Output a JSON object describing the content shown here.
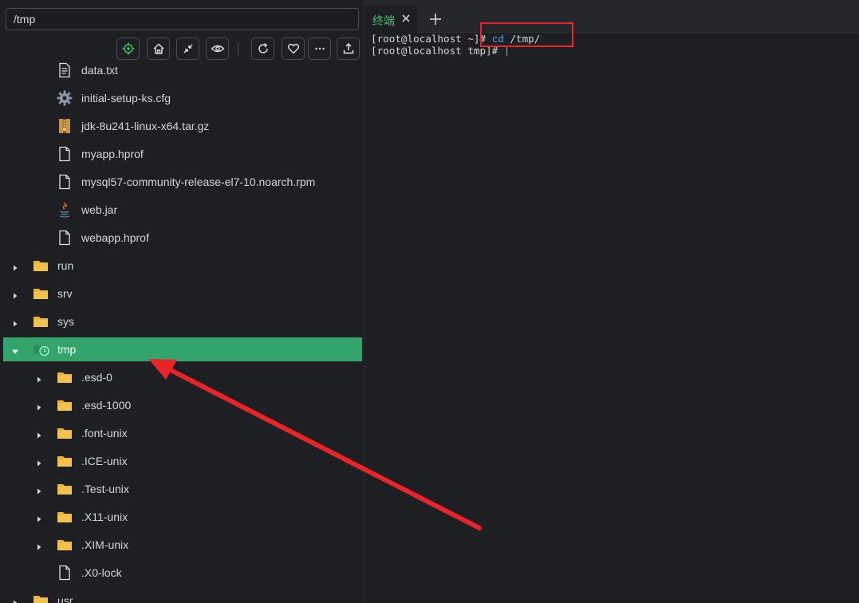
{
  "path_bar": {
    "value": "/tmp"
  },
  "toolbar": {
    "buttons": [
      {
        "icon": "locate-icon"
      },
      {
        "icon": "home-icon"
      },
      {
        "icon": "collapse-icon"
      },
      {
        "icon": "eye-icon"
      },
      {
        "icon": "refresh-icon"
      },
      {
        "icon": "heart-icon"
      },
      {
        "icon": "more-icon"
      },
      {
        "icon": "upload-icon"
      }
    ]
  },
  "tree": {
    "items": [
      {
        "label": "data.txt",
        "icon": "text-file-icon",
        "depth": 2
      },
      {
        "label": "initial-setup-ks.cfg",
        "icon": "gear-file-icon",
        "depth": 2
      },
      {
        "label": "jdk-8u241-linux-x64.tar.gz",
        "icon": "archive-file-icon",
        "depth": 2
      },
      {
        "label": "myapp.hprof",
        "icon": "file-icon",
        "depth": 2
      },
      {
        "label": "mysql57-community-release-el7-10.noarch.rpm",
        "icon": "file-icon",
        "depth": 2
      },
      {
        "label": "web.jar",
        "icon": "java-file-icon",
        "depth": 2
      },
      {
        "label": "webapp.hprof",
        "icon": "file-icon",
        "depth": 2
      },
      {
        "label": "run",
        "icon": "folder-icon",
        "depth": 1,
        "expander": "collapsed"
      },
      {
        "label": "srv",
        "icon": "folder-icon",
        "depth": 1,
        "expander": "collapsed"
      },
      {
        "label": "sys",
        "icon": "folder-icon",
        "depth": 1,
        "expander": "collapsed"
      },
      {
        "label": "tmp",
        "icon": "temp-folder-icon",
        "depth": 1,
        "expander": "expanded",
        "selected": true
      },
      {
        "label": ".esd-0",
        "icon": "folder-icon",
        "depth": 2,
        "expander": "collapsed"
      },
      {
        "label": ".esd-1000",
        "icon": "folder-icon",
        "depth": 2,
        "expander": "collapsed"
      },
      {
        "label": ".font-unix",
        "icon": "folder-icon",
        "depth": 2,
        "expander": "collapsed"
      },
      {
        "label": ".ICE-unix",
        "icon": "folder-icon",
        "depth": 2,
        "expander": "collapsed"
      },
      {
        "label": ".Test-unix",
        "icon": "folder-icon",
        "depth": 2,
        "expander": "collapsed"
      },
      {
        "label": ".X11-unix",
        "icon": "folder-icon",
        "depth": 2,
        "expander": "collapsed"
      },
      {
        "label": ".XIM-unix",
        "icon": "folder-icon",
        "depth": 2,
        "expander": "collapsed"
      },
      {
        "label": ".X0-lock",
        "icon": "file-icon",
        "depth": 2
      },
      {
        "label": "usr",
        "icon": "folder-icon",
        "depth": 1,
        "expander": "collapsed"
      }
    ]
  },
  "terminal_tabs": {
    "active_tab_label": "终端",
    "add_tab_label": "+"
  },
  "terminal": {
    "lines": [
      {
        "prompt": "[root@localhost ~]# ",
        "command": "cd",
        "args": " /tmp/"
      },
      {
        "prompt": "[root@localhost tmp]# ",
        "command": "",
        "args": ""
      }
    ]
  },
  "colors": {
    "selection": "#33a56c",
    "folder": "#e8b33a",
    "tab_label": "#3fbf6a",
    "command": "#4f9fe0",
    "annotation_red": "#e8232a"
  }
}
